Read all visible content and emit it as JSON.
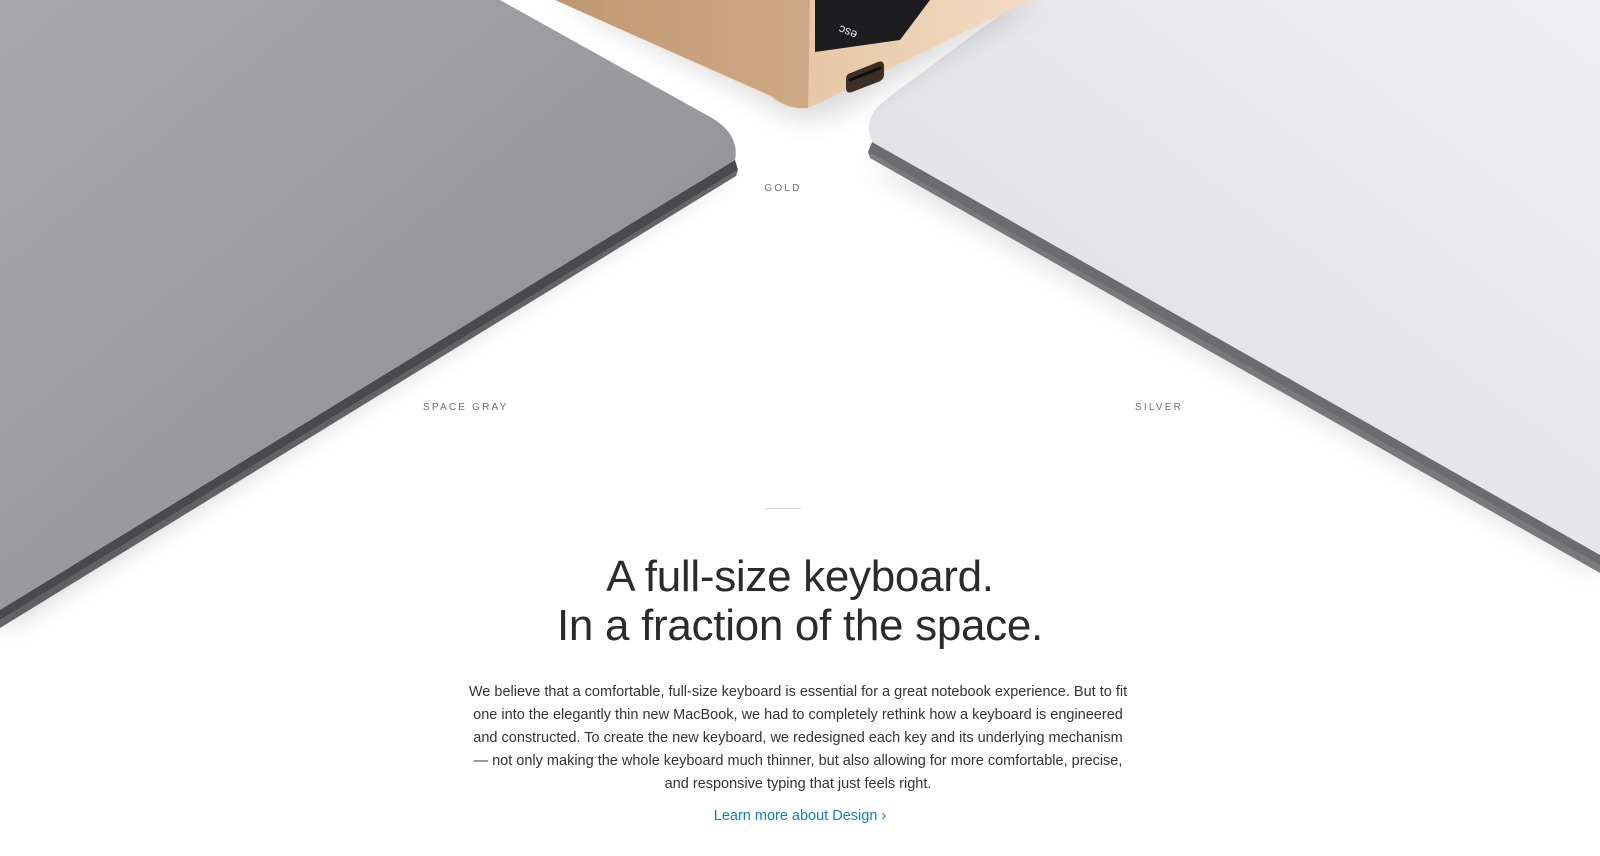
{
  "colors": {
    "gold_label": "GOLD",
    "space_gray_label": "SPACE GRAY",
    "silver_label": "SILVER"
  },
  "keyboard": {
    "esc_key": "esc"
  },
  "section": {
    "headline_line1": "A full-size keyboard.",
    "headline_line2": "In a fraction of the space.",
    "body": "We believe that a comfortable, full-size keyboard is essential for a great notebook experience. But to fit one into the elegantly thin new MacBook, we had to completely rethink how a keyboard is engineered and constructed. To create the new keyboard, we redesigned each key and its underlying mechanism — not only making the whole keyboard much thinner, but also allowing for more comfortable, precise, and responsive typing that just feels right.",
    "link_label": "Learn more about Design ›"
  },
  "palette": {
    "link": "#0f7fc4",
    "text": "#333336",
    "headline": "#2b2b2e",
    "label": "#6e6e73",
    "gold": "#d9b38c",
    "space_gray": "#9a9aa0",
    "silver": "#e6e6ea"
  }
}
